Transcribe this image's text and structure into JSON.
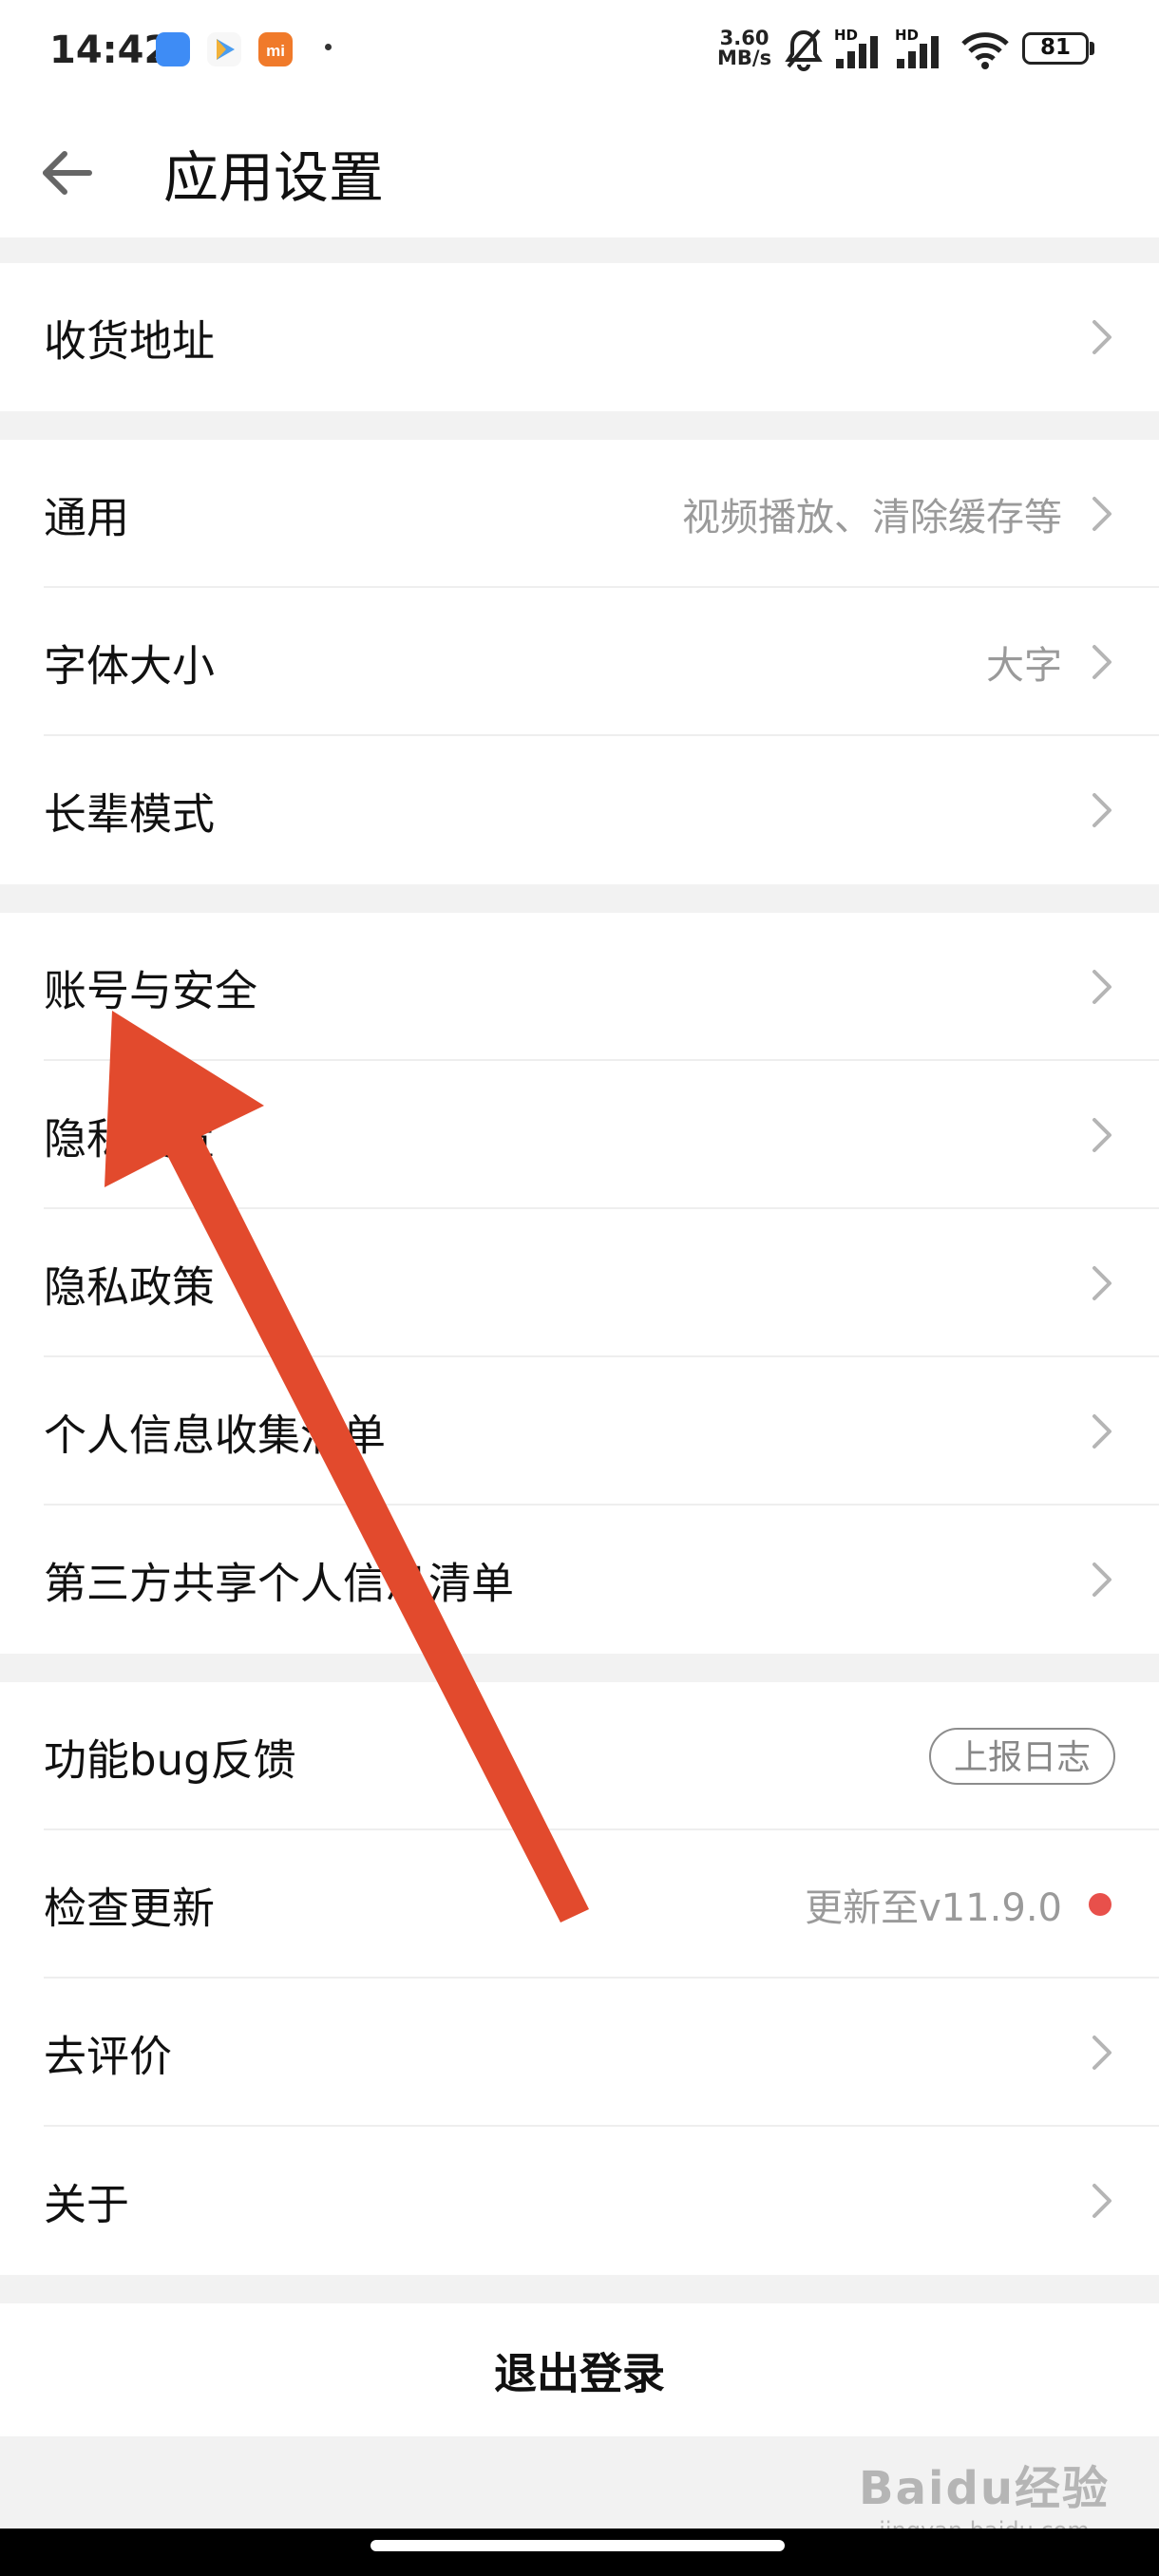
{
  "status_bar": {
    "time": "14:42",
    "net_speed_value": "3.60",
    "net_speed_unit": "MB/s",
    "battery": "81",
    "signal1_label": "HD",
    "signal2_label": "HD"
  },
  "header": {
    "title": "应用设置"
  },
  "groups": {
    "address": {
      "label": "收货地址"
    },
    "general": {
      "label": "通用",
      "value": "视频播放、清除缓存等"
    },
    "font_size": {
      "label": "字体大小",
      "value": "大字"
    },
    "elder_mode": {
      "label": "长辈模式"
    },
    "account_security": {
      "label": "账号与安全"
    },
    "privacy_settings": {
      "label": "隐私设置"
    },
    "privacy_policy": {
      "label": "隐私政策"
    },
    "info_collection": {
      "label": "个人信息收集清单"
    },
    "third_party": {
      "label": "第三方共享个人信息清单"
    },
    "bug_feedback": {
      "label": "功能bug反馈",
      "action": "上报日志"
    },
    "check_update": {
      "label": "检查更新",
      "value": "更新至v11.9.0"
    },
    "rate": {
      "label": "去评价"
    },
    "about": {
      "label": "关于"
    }
  },
  "logout": {
    "label": "退出登录"
  },
  "watermark": {
    "logo": "Baidu经验",
    "url": "jingyan.baidu.com"
  },
  "colors": {
    "accent_arrow": "#e24a2d",
    "update_dot": "#e8504b",
    "secondary_text": "#9a9a9a"
  }
}
